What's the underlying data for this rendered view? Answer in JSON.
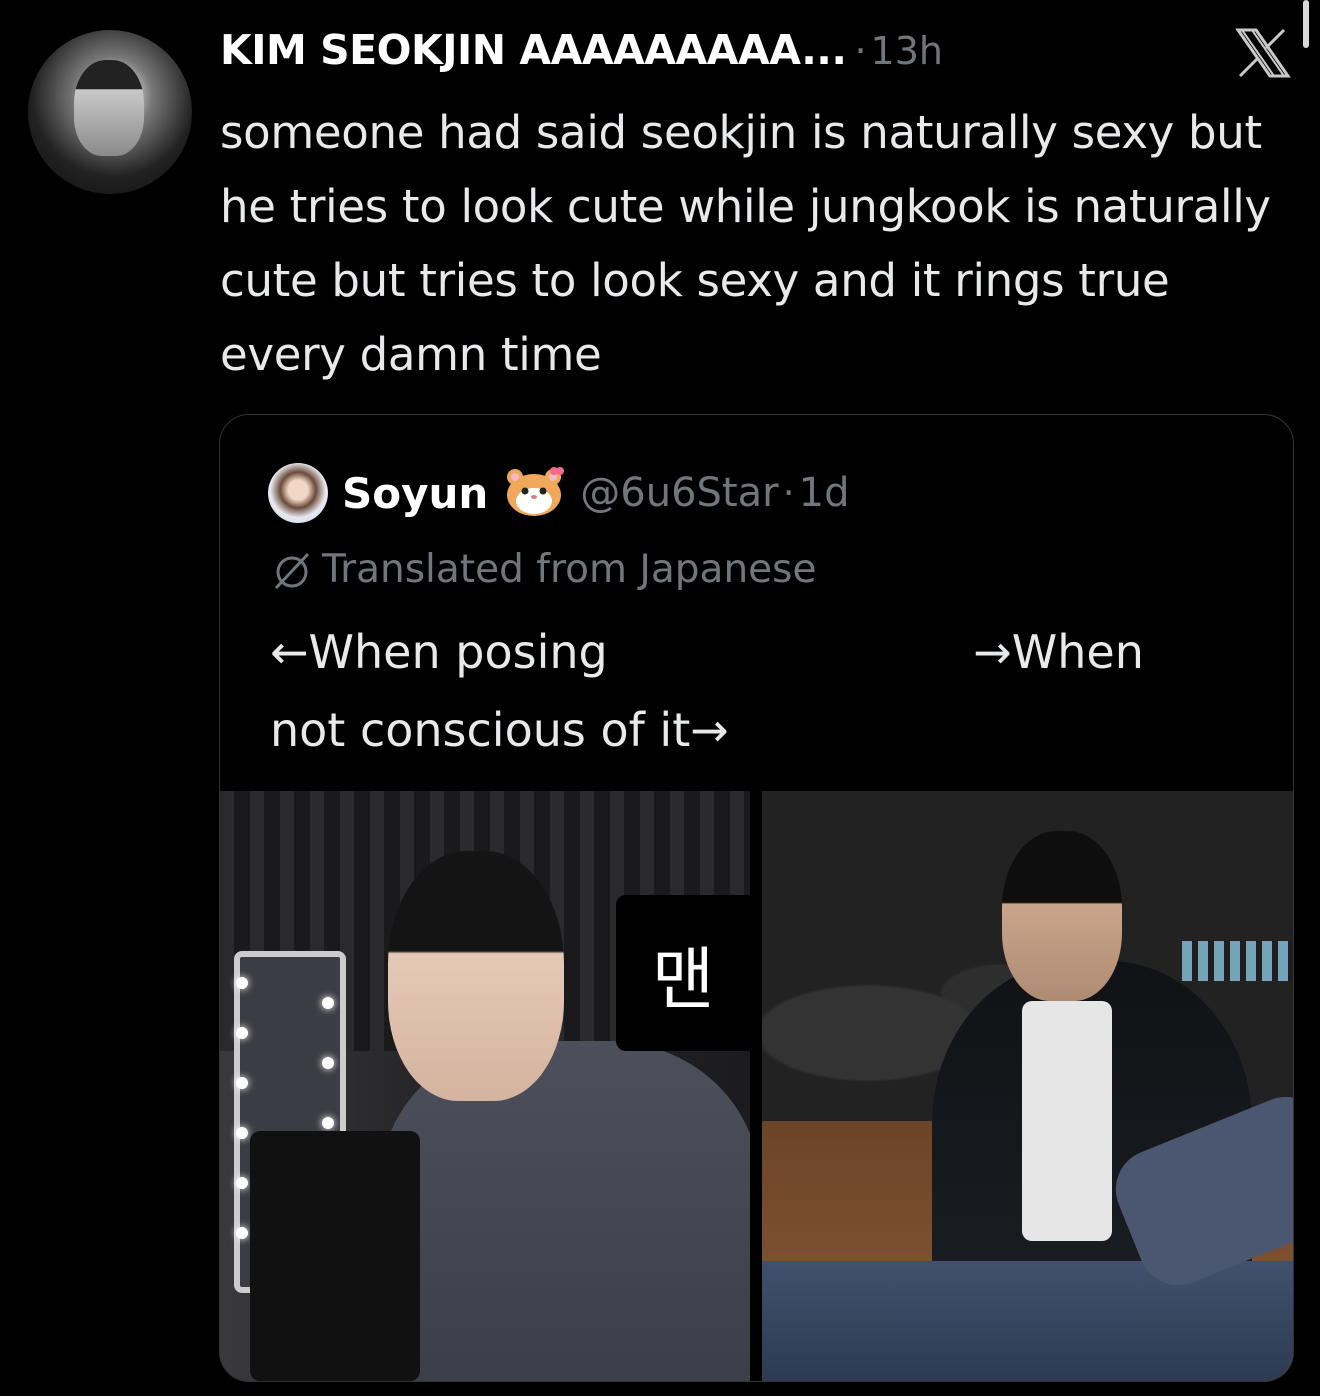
{
  "tweet": {
    "display_name": "KIM SEOKJIN AAAAAAAAA...",
    "separator": "·",
    "time": "13h",
    "text": "someone had said seokjin is naturally sexy but he tries to look cute while jungkook is naturally cute but tries to look sexy and it rings true every damn time",
    "avatar_icon": "profile-photo"
  },
  "header": {
    "close_icon": "x-close-icon",
    "close_glyph": "𝕏"
  },
  "quote": {
    "name": "Soyun",
    "name_emoji": "🐹",
    "handle": "@6u6Star",
    "separator": "·",
    "time": "1d",
    "translated_label": "Translated from Japanese",
    "text": "←When posing                         →When\nnot conscious of it→",
    "media": {
      "left_overlay_text": "맨"
    }
  },
  "colors": {
    "background": "#000000",
    "primary_text": "#e7e9ea",
    "secondary_text": "#71767b",
    "border": "#2f3336"
  }
}
